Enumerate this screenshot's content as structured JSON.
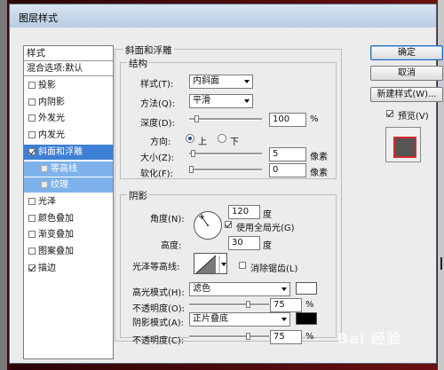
{
  "window": {
    "title": "图层样式"
  },
  "left_panel": {
    "header": "样式",
    "blend_options": "混合选项:默认",
    "items": [
      {
        "label": "投影",
        "checked": false
      },
      {
        "label": "内阴影",
        "checked": false
      },
      {
        "label": "外发光",
        "checked": false
      },
      {
        "label": "内发光",
        "checked": false
      },
      {
        "label": "斜面和浮雕",
        "checked": true,
        "selected": true
      },
      {
        "label": "等高线",
        "checked": false,
        "sub": true
      },
      {
        "label": "纹理",
        "checked": false,
        "sub": true
      },
      {
        "label": "光泽",
        "checked": false
      },
      {
        "label": "颜色叠加",
        "checked": false
      },
      {
        "label": "渐变叠加",
        "checked": false
      },
      {
        "label": "图案叠加",
        "checked": false
      },
      {
        "label": "描边",
        "checked": true
      }
    ]
  },
  "bevel": {
    "title": "斜面和浮雕",
    "structure": {
      "title": "结构",
      "style_label": "样式(T):",
      "style_value": "内斜面",
      "technique_label": "方法(Q):",
      "technique_value": "平滑",
      "depth_label": "深度(D):",
      "depth_value": "100",
      "depth_unit": "%",
      "direction_label": "方向:",
      "direction_up": "上",
      "direction_down": "下",
      "size_label": "大小(Z):",
      "size_value": "5",
      "size_unit": "像素",
      "soften_label": "软化(F):",
      "soften_value": "0",
      "soften_unit": "像素"
    },
    "shading": {
      "title": "阴影",
      "angle_label": "角度(N):",
      "angle_value": "120",
      "angle_unit": "度",
      "global_light_label": "使用全局光(G)",
      "global_light_checked": true,
      "altitude_label": "高度:",
      "altitude_value": "30",
      "altitude_unit": "度",
      "gloss_label": "光泽等高线:",
      "antialias_label": "消除锯齿(L)",
      "antialias_checked": false,
      "highlight_mode_label": "高光模式(H):",
      "highlight_mode_value": "滤色",
      "highlight_color": "#ffffff",
      "highlight_opacity_label": "不透明度(O):",
      "highlight_opacity_value": "75",
      "highlight_opacity_unit": "%",
      "shadow_mode_label": "阴影模式(A):",
      "shadow_mode_value": "正片叠底",
      "shadow_color": "#000000",
      "shadow_opacity_label": "不透明度(C):",
      "shadow_opacity_value": "75",
      "shadow_opacity_unit": "%"
    }
  },
  "buttons": {
    "ok": "确定",
    "cancel": "取消",
    "new_style": "新建样式(W)..."
  },
  "preview": {
    "label": "预览(V)",
    "checked": true
  },
  "watermark": "Bai 经验",
  "colors": {
    "accent": "#3d7fd4",
    "sub_selected": "#7fb2ea",
    "stroke_preview": "#d62a2a"
  }
}
